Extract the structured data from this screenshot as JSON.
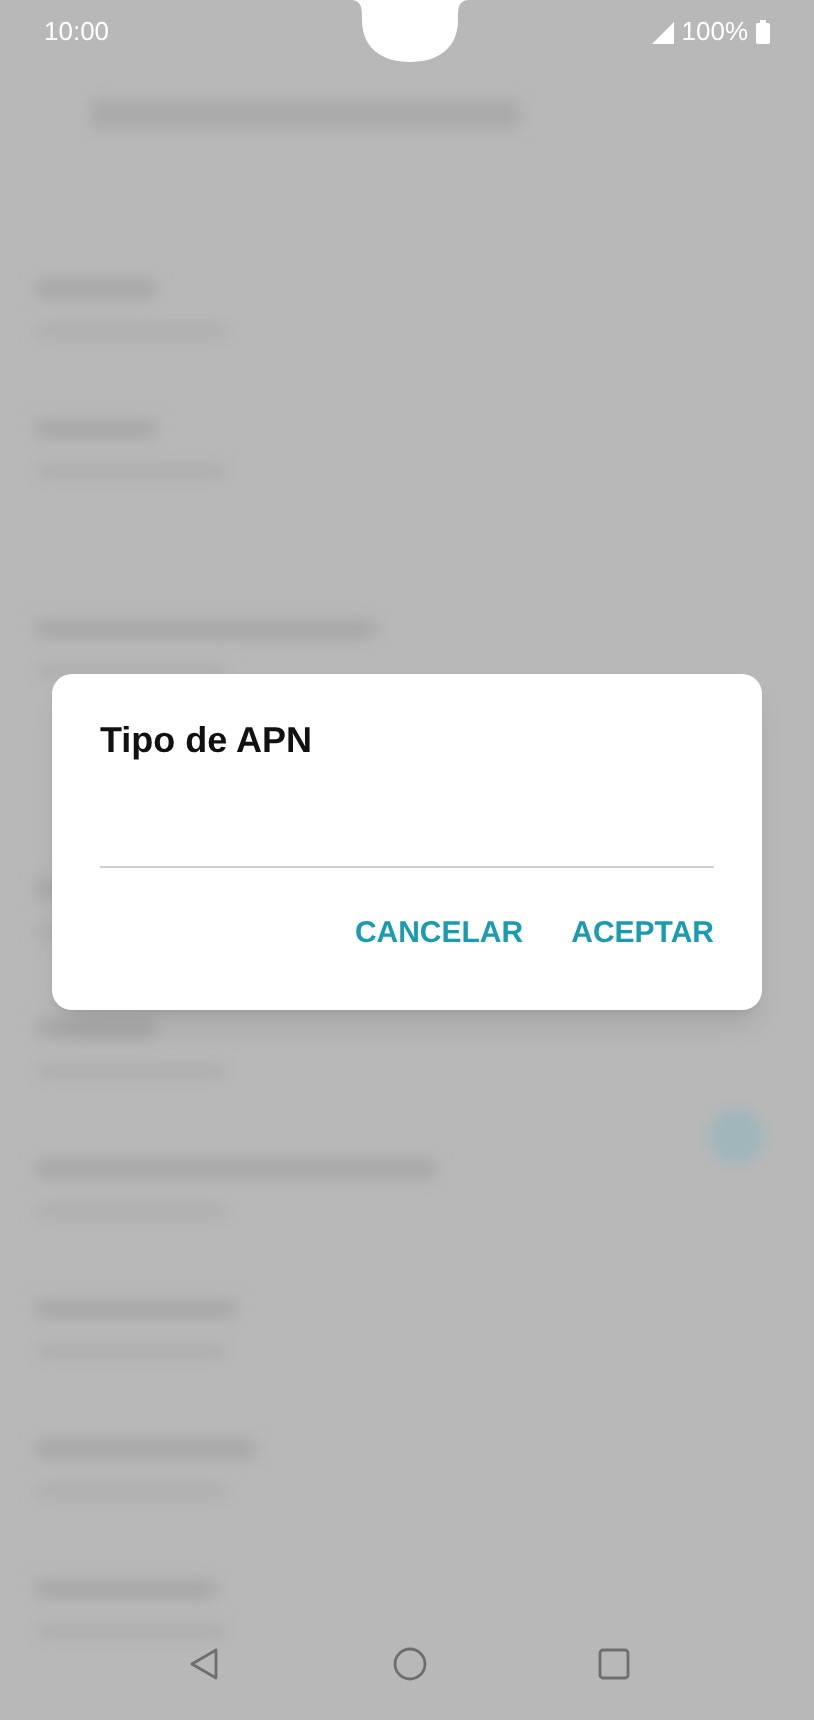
{
  "status_bar": {
    "time": "10:00",
    "battery": "100%"
  },
  "dialog": {
    "title": "Tipo de APN",
    "buttons": [
      "CANCELAR",
      "ACEPTAR"
    ]
  },
  "nav_bar": {
    "buttons": [
      {
        "kind": "back"
      },
      {
        "kind": "home"
      },
      {
        "kind": "recents"
      }
    ]
  }
}
